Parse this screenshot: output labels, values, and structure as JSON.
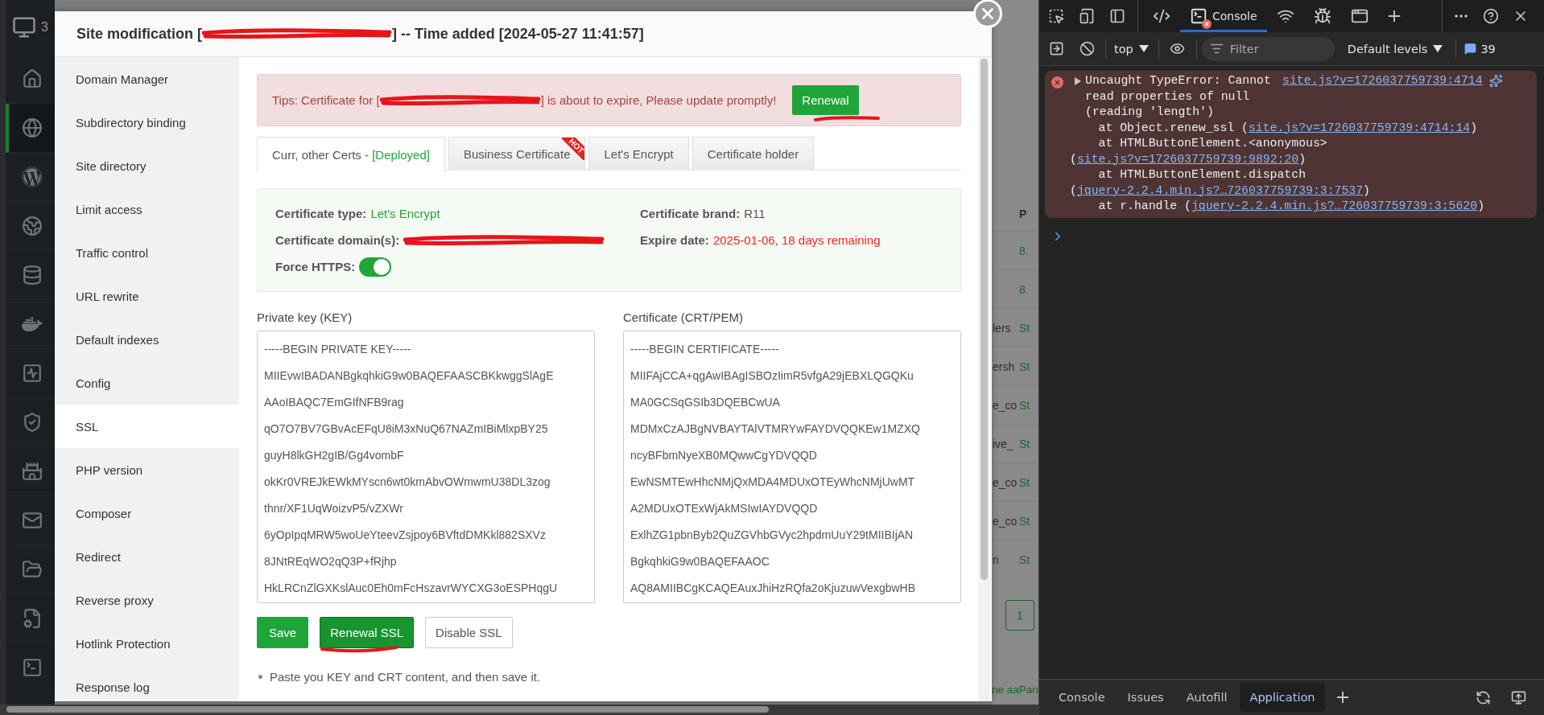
{
  "left_nav": {
    "counter": "3",
    "items": [
      {
        "kind": "home",
        "selected": false
      },
      {
        "kind": "sites",
        "selected": true
      },
      {
        "kind": "wordpress",
        "selected": false
      },
      {
        "kind": "nodes",
        "selected": false
      },
      {
        "kind": "database",
        "selected": false
      },
      {
        "kind": "docker",
        "selected": false
      },
      {
        "kind": "monitor",
        "selected": false
      },
      {
        "kind": "security",
        "selected": false
      },
      {
        "kind": "firewall",
        "selected": false
      },
      {
        "kind": "mail",
        "selected": false
      },
      {
        "kind": "files",
        "selected": false
      },
      {
        "kind": "logs",
        "selected": false
      },
      {
        "kind": "terminal",
        "selected": false
      }
    ]
  },
  "background_table": {
    "header": "P",
    "rows": [
      {
        "column_2": "8."
      },
      {
        "column_2": "8."
      },
      {
        "column_1": "lers",
        "column_2": "St"
      },
      {
        "column_1": "ersh",
        "column_2": "St"
      },
      {
        "column_1": "e_co",
        "column_2": "St"
      },
      {
        "column_1": "ive_",
        "column_2": "St"
      },
      {
        "column_1": "e_co",
        "column_2": "St"
      },
      {
        "column_1": "e_co",
        "column_2": "St"
      },
      {
        "column_1": "n",
        "column_2": "St"
      }
    ],
    "pagination": {
      "page": "1"
    },
    "footer_link": "ne aaPan"
  },
  "dialog": {
    "title_start": "Site modification [",
    "title_end": "] -- Time added [2024-05-27 11:41:57]",
    "sidebar": [
      {
        "label": "Domain Manager",
        "selected": false
      },
      {
        "label": "Subdirectory binding",
        "selected": false
      },
      {
        "label": "Site directory",
        "selected": false
      },
      {
        "label": "Limit access",
        "selected": false
      },
      {
        "label": "Traffic control",
        "selected": false
      },
      {
        "label": "URL rewrite",
        "selected": false
      },
      {
        "label": "Default indexes",
        "selected": false
      },
      {
        "label": "Config",
        "selected": false
      },
      {
        "label": "SSL",
        "selected": true
      },
      {
        "label": "PHP version",
        "selected": false
      },
      {
        "label": "Composer",
        "selected": false
      },
      {
        "label": "Redirect",
        "selected": false
      },
      {
        "label": "Reverse proxy",
        "selected": false
      },
      {
        "label": "Hotlink Protection",
        "selected": false
      },
      {
        "label": "Response log",
        "selected": false
      }
    ],
    "alert": {
      "text_start": "Tips: Certificate for [",
      "text_end": "] is about to expire, Please update promptly!",
      "button": "Renewal"
    },
    "tabs": [
      {
        "label": "Curr, other Certs -",
        "status": "[Deployed]",
        "selected": true
      },
      {
        "label": "Business Certificate",
        "badge": "HOT",
        "selected": false
      },
      {
        "label": "Let's Encrypt",
        "selected": false
      },
      {
        "label": "Certificate holder",
        "selected": false
      }
    ],
    "certificate": {
      "type_label": "Certificate type:",
      "type_value": "Let's Encrypt",
      "brand_label": "Certificate brand:",
      "brand_value": "R11",
      "domain_label": "Certificate domain(s):",
      "expire_label": "Expire date:",
      "expire_value": "2025-01-06, 18 days remaining",
      "force_https_label": "Force HTTPS:",
      "force_https_on": true
    },
    "key_field": {
      "label": "Private key (KEY)",
      "lines": [
        "-----BEGIN PRIVATE KEY-----",
        "MIIEvwIBADANBgkqhkiG9w0BAQEFAASCBKkwggSlAgE",
        "AAoIBAQC7EmGIfNFB9rag",
        "qO7O7BV7GBvAcEFqU8iM3xNuQ67NAZmIBiMlxpBY25",
        "guyH8lkGH2gIB/Gg4vombF",
        "okKr0VREJkEWkMYscn6wt0kmAbvOWmwmU38DL3zog",
        "thnr/XF1UqWoizvP5/vZXWr",
        "6yOpIpqMRW5woUeYteevZsjpoy6BVftdDMKkl882SXVz",
        "8JNtREqWO2qQ3P+fRjhp",
        "HkLRCnZlGXKslAuc0Eh0mFcHszavrWYCXG3oESPHqgU"
      ]
    },
    "cert_field": {
      "label": "Certificate (CRT/PEM)",
      "lines": [
        "-----BEGIN CERTIFICATE-----",
        "MIIFAjCCA+qgAwIBAgISBOzIimR5vfgA29jEBXLQGQKu",
        "MA0GCSqGSIb3DQEBCwUA",
        "MDMxCzAJBgNVBAYTAlVTMRYwFAYDVQQKEw1MZXQ",
        "ncyBFbmNyeXB0MQwwCgYDVQQD",
        "EwNSMTEwHhcNMjQxMDA4MDUxOTEyWhcNMjUwMT",
        "A2MDUxOTExWjAkMSIwIAYDVQQD",
        "ExlhZG1pbnByb2QuZGVhbGVyc2hpdmUuY29tMIIBIjAN",
        "BgkqhkiG9w0BAQEFAAOC",
        "AQ8AMIIBCgKCAQEAuxJhiHzRQfa2oKjuzuwVexgbwHB"
      ]
    },
    "buttons": [
      {
        "label": "Save",
        "kind": "primary"
      },
      {
        "label": "Renewal SSL",
        "kind": "dark"
      },
      {
        "label": "Disable SSL",
        "kind": "default"
      }
    ],
    "notes": [
      "Paste you KEY and CRT content, and then save it."
    ]
  },
  "devtools": {
    "panel_tabs": [
      {
        "kind": "elements",
        "selected": false
      },
      {
        "kind": "console",
        "label": "Console",
        "selected": true,
        "error": true
      },
      {
        "kind": "network",
        "selected": false
      },
      {
        "kind": "sources",
        "selected": false
      },
      {
        "kind": "application",
        "selected": false
      }
    ],
    "context": "top",
    "filter": {
      "placeholder": "Filter"
    },
    "levels": "Default levels",
    "message_count": "39",
    "error": {
      "message": "Uncaught TypeError: Cannot read properties of null (reading 'length')",
      "source": "site.js?v=1726037759739:4714",
      "stack": [
        {
          "text": "at Object.renew_ssl (",
          "link": "site.js?v=1726037759739:4714:14",
          "end": ")"
        },
        {
          "text": "at HTMLButtonElement.<anonymous> (",
          "link": "site.js?v=1726037759739:9892:20",
          "end": ")"
        },
        {
          "text": "at HTMLButtonElement.dispatch (",
          "link": "jquery-2.2.4.min.js?…726037759739:3:7537",
          "end": ")"
        },
        {
          "text": "at r.handle (",
          "link": "jquery-2.2.4.min.js?…726037759739:3:5620",
          "end": ")"
        }
      ]
    },
    "drawer_tabs": [
      {
        "label": "Console",
        "selected": false
      },
      {
        "label": "Issues",
        "selected": false
      },
      {
        "label": "Autofill",
        "selected": false
      },
      {
        "label": "Application",
        "selected": true
      }
    ]
  }
}
